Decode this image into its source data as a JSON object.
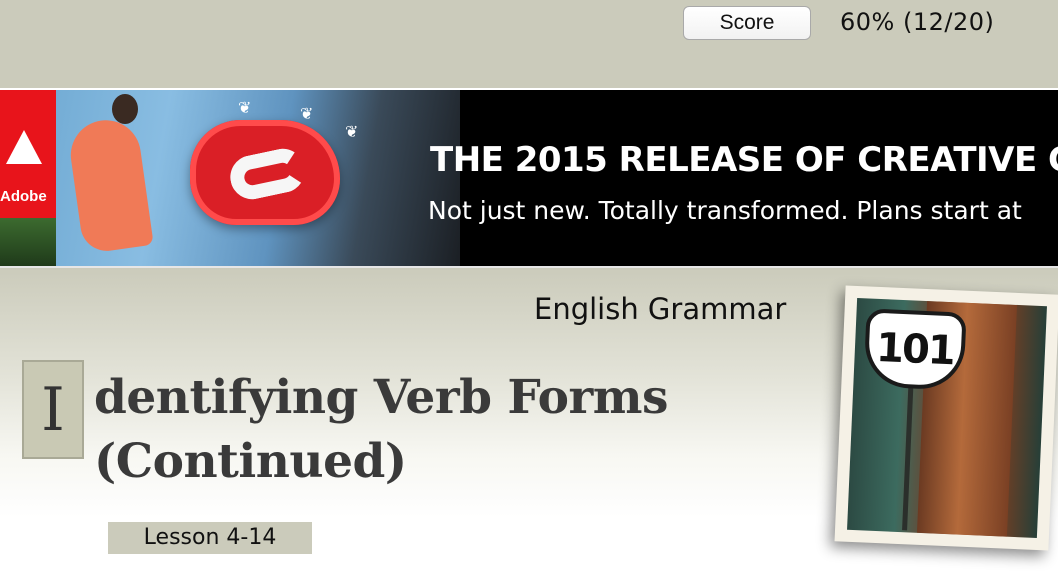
{
  "score": {
    "button_label": "Score",
    "value": "60% (12/20)"
  },
  "ad": {
    "brand": "Adobe",
    "headline": "THE 2015 RELEASE OF CREATIVE C",
    "subline": "Not just new. Totally transformed. Plans start at"
  },
  "lesson": {
    "subject": "English Grammar",
    "dropcap": "I",
    "title": "dentifying Verb Forms (Continued)",
    "tag": "Lesson 4-14"
  },
  "photo": {
    "sign_text": "101"
  }
}
